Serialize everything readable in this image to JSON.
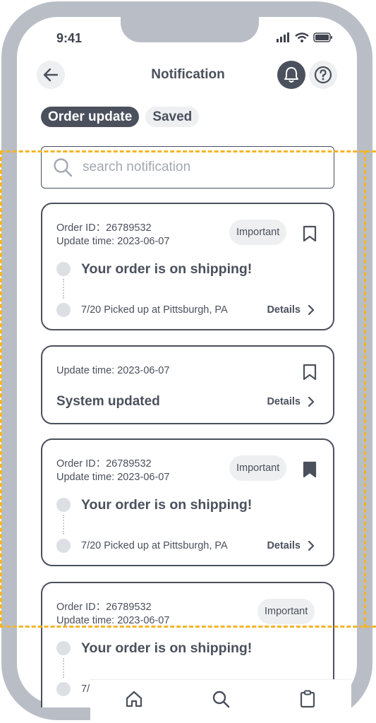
{
  "status_bar": {
    "time": "9:41"
  },
  "header": {
    "title": "Notification"
  },
  "tabs": [
    {
      "label": "Order update",
      "active": true
    },
    {
      "label": "Saved",
      "active": false
    }
  ],
  "search": {
    "placeholder": "search notification"
  },
  "cards": [
    {
      "order_id": "Order ID：26789532",
      "update_time": "Update time:  2023-06-07",
      "badge": "Important",
      "bookmarked": false,
      "headline": "Your order is on shipping!",
      "pickup": "7/20 Picked up at Pittsburgh, PA",
      "details_label": "Details"
    },
    {
      "update_time": "Update time:  2023-06-07",
      "bookmarked": false,
      "headline": "System updated",
      "details_label": "Details"
    },
    {
      "order_id": "Order ID：26789532",
      "update_time": "Update time:  2023-06-07",
      "badge": "Important",
      "bookmarked": true,
      "headline": "Your order is on shipping!",
      "pickup": "7/20 Picked up at Pittsburgh, PA",
      "details_label": "Details"
    },
    {
      "order_id": "Order ID：26789532",
      "update_time": "Update time:  2023-06-07",
      "badge": "Important",
      "headline": "Your order is on shipping!",
      "pickup_partial": "7/"
    }
  ],
  "bottom_nav": [
    "home-icon",
    "search-icon",
    "clipboard-icon"
  ],
  "colors": {
    "primary": "#4a505c",
    "frame": "#b9bec6",
    "chip_bg": "#eeeff1",
    "highlight_dashed": "#f3b529"
  }
}
